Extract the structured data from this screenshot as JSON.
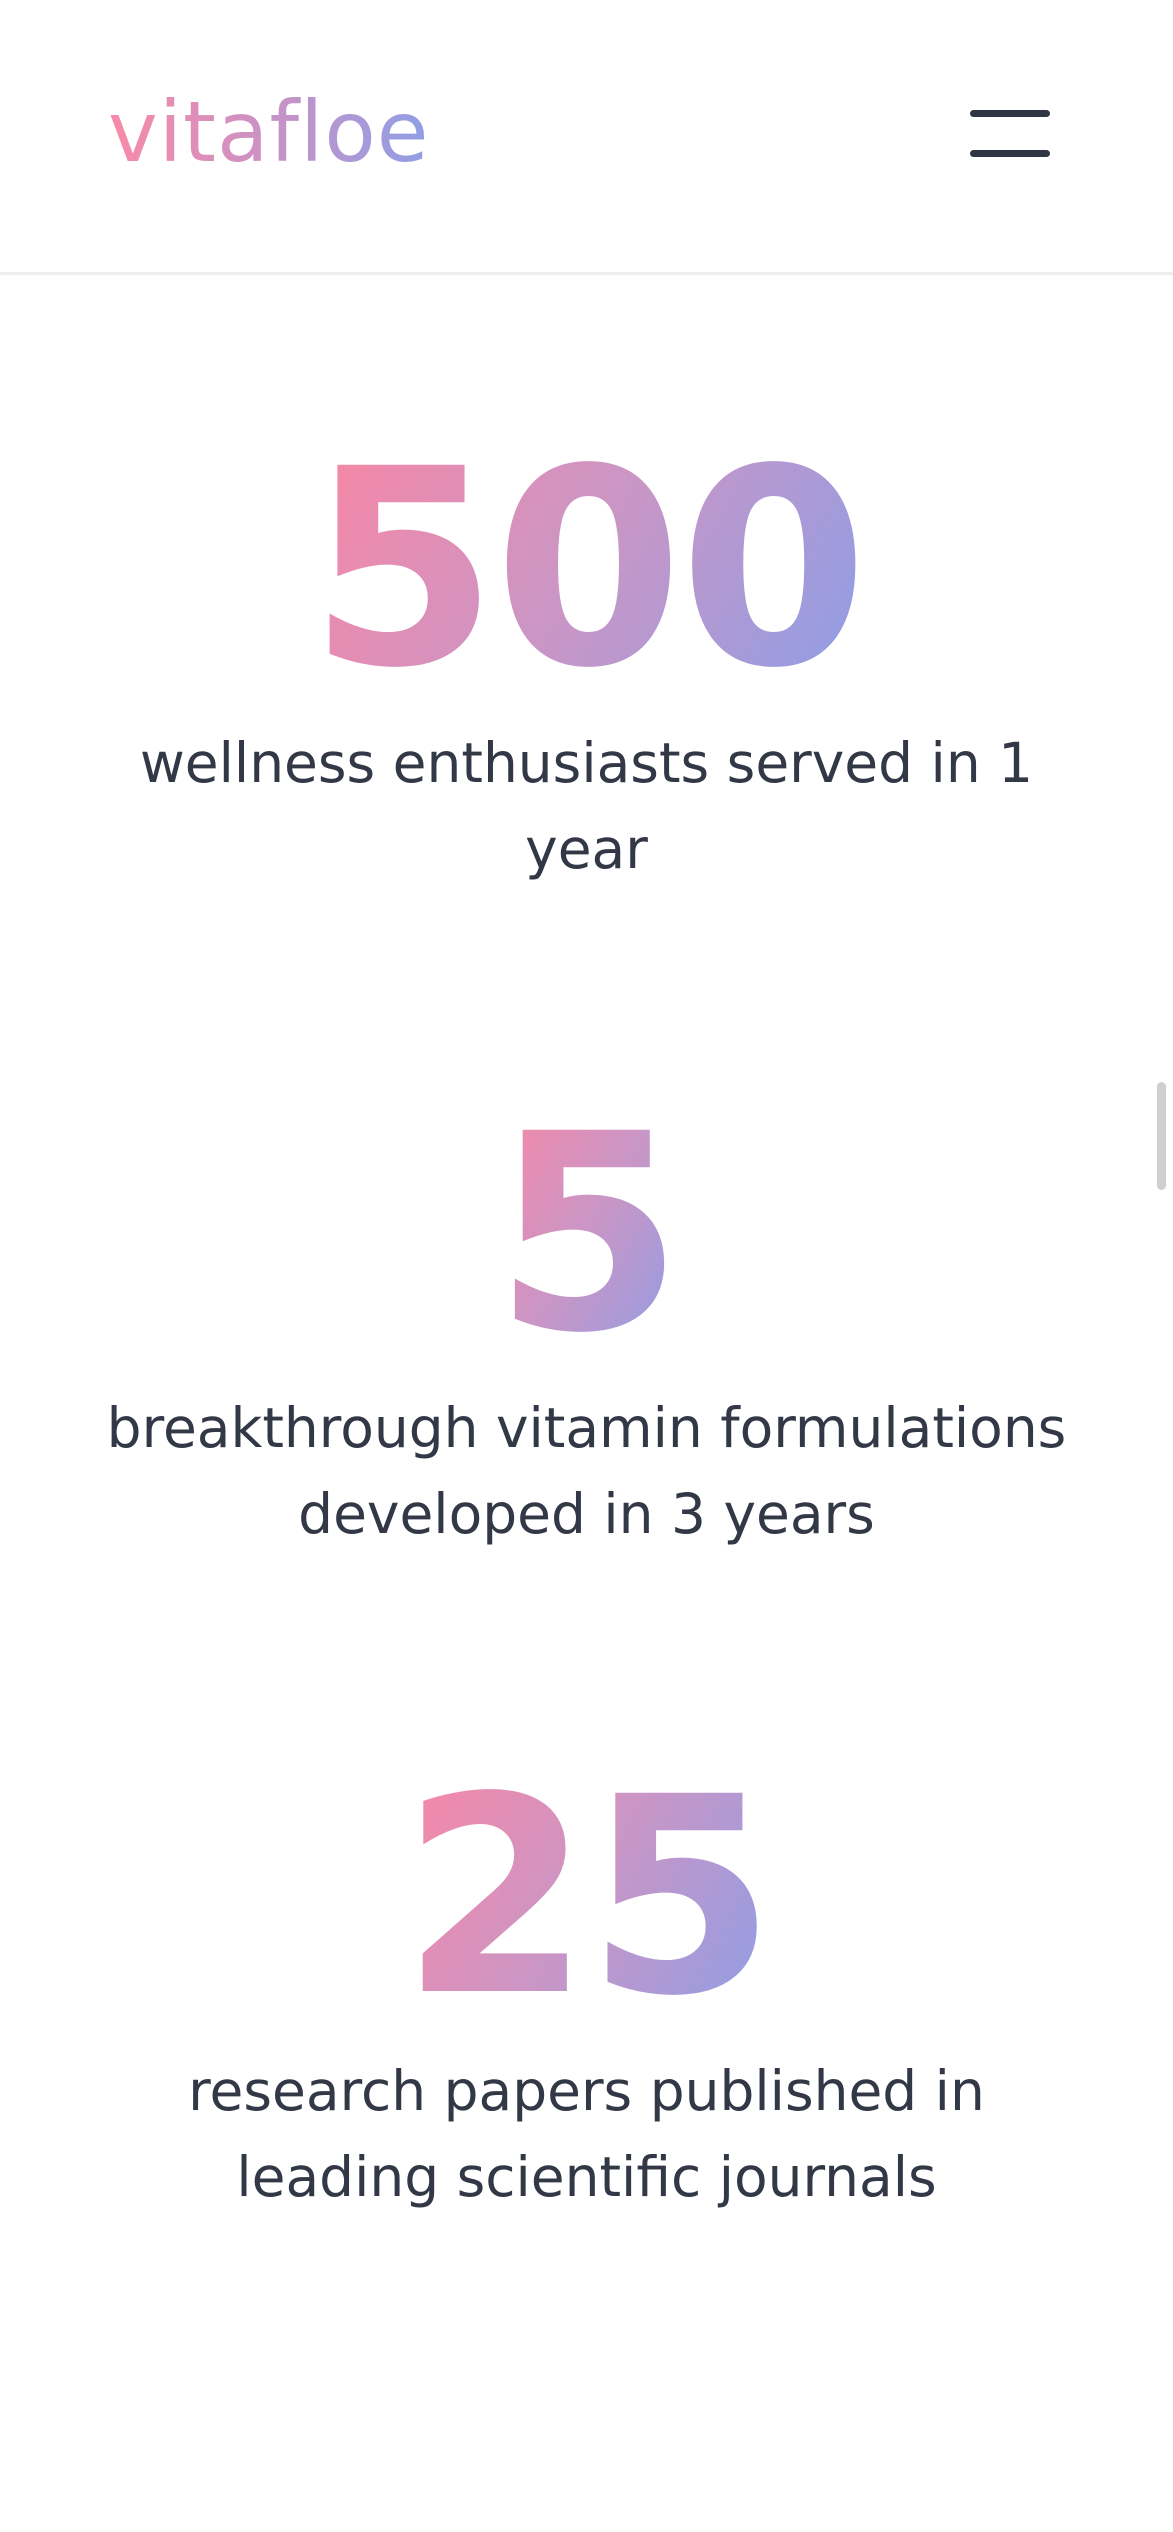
{
  "header": {
    "logo_text": "vitafloe",
    "menu_icon": "hamburger-menu-icon"
  },
  "colors": {
    "gradient_start": "#f98aa8",
    "gradient_mid": "#c493c8",
    "gradient_end": "#8f9fe6",
    "text_dark": "#333846"
  },
  "stats": [
    {
      "number": "500",
      "description": "wellness enthusiasts served in 1 year"
    },
    {
      "number": "5",
      "description": "breakthrough vitamin formulations developed in 3 years"
    },
    {
      "number": "25",
      "description": "research papers published in leading scientific journals"
    }
  ]
}
